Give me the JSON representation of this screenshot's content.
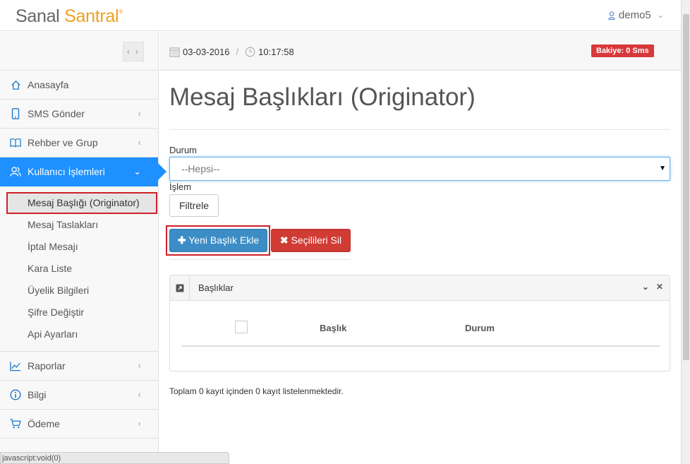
{
  "brand": {
    "part1": "Sanal",
    "part2": "Santral",
    "mark": "®"
  },
  "user": {
    "name": "demo5"
  },
  "statusbar": {
    "text": "javascript:void(0)"
  },
  "header": {
    "date": "03-03-2016",
    "time": "10:17:58",
    "balance": "Bakiye: 0 Sms"
  },
  "sidebar": {
    "toggle": "‹ ›",
    "items": [
      {
        "label": "Anasayfa",
        "icon": "home-icon"
      },
      {
        "label": "SMS Gönder",
        "icon": "mobile-icon"
      },
      {
        "label": "Rehber ve Grup",
        "icon": "book-icon"
      },
      {
        "label": "Kullanıcı İşlemleri",
        "icon": "users-icon"
      }
    ],
    "submenu": [
      "Mesaj Başlığı (Originator)",
      "Mesaj Taslakları",
      "İptal Mesajı",
      "Kara Liste",
      "Üyelik Bilgileri",
      "Şifre Değiştir",
      "Api Ayarları"
    ],
    "items2": [
      {
        "label": "Raporlar",
        "icon": "chart-icon"
      },
      {
        "label": "Bilgi",
        "icon": "info-icon"
      },
      {
        "label": "Ödeme",
        "icon": "cart-icon"
      }
    ]
  },
  "main": {
    "title": "Mesaj Başlıkları (Originator)",
    "status_label": "Durum",
    "status_value": "--Hepsi--",
    "action_label": "İşlem",
    "filter_button": "Filtrele",
    "new_button": "Yeni Başlık Ekle",
    "delete_button": "Seçilileri Sil",
    "panel_title": "Başlıklar",
    "columns": [
      "Başlık",
      "Durum"
    ],
    "summary": "Toplam 0 kayıt içinden 0 kayıt listelenmektedir."
  },
  "colors": {
    "accent": "#1e90ff",
    "primary_button": "#3c8dc5",
    "danger_button": "#d03b34",
    "brand_orange": "#f0a020",
    "highlight_red": "#d0202a"
  }
}
